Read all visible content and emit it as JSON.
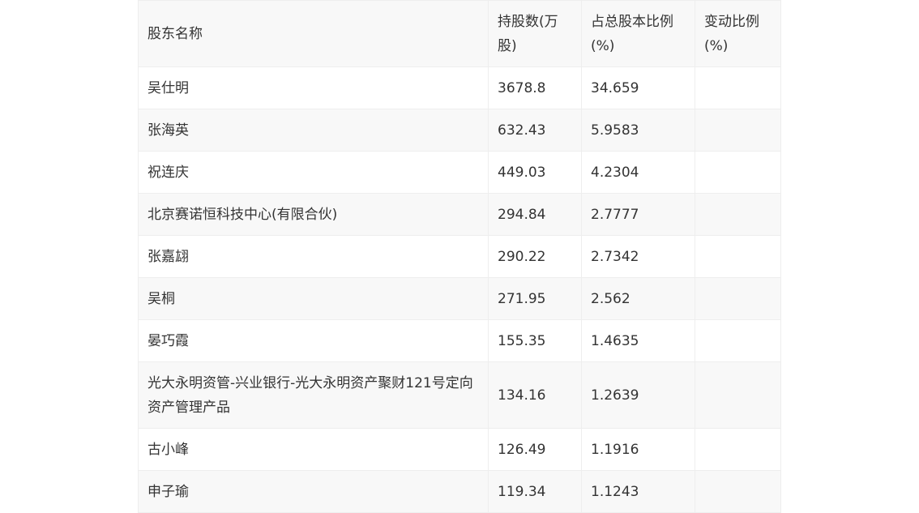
{
  "table": {
    "headers": [
      "股东名称",
      "持股数(万股)",
      "占总股本比例(%)",
      "变动比例(%)"
    ],
    "rows": [
      {
        "name": "吴仕明",
        "shares": "3678.8",
        "ratio": "34.659",
        "change": ""
      },
      {
        "name": "张海英",
        "shares": "632.43",
        "ratio": "5.9583",
        "change": ""
      },
      {
        "name": "祝连庆",
        "shares": "449.03",
        "ratio": "4.2304",
        "change": ""
      },
      {
        "name": "北京赛诺恒科技中心(有限合伙)",
        "shares": "294.84",
        "ratio": "2.7777",
        "change": ""
      },
      {
        "name": "张嘉翃",
        "shares": "290.22",
        "ratio": "2.7342",
        "change": ""
      },
      {
        "name": "吴桐",
        "shares": "271.95",
        "ratio": "2.562",
        "change": ""
      },
      {
        "name": "晏巧霞",
        "shares": "155.35",
        "ratio": "1.4635",
        "change": ""
      },
      {
        "name": "光大永明资管-兴业银行-光大永明资产聚财121号定向资产管理产品",
        "shares": "134.16",
        "ratio": "1.2639",
        "change": ""
      },
      {
        "name": "古小峰",
        "shares": "126.49",
        "ratio": "1.1916",
        "change": ""
      },
      {
        "name": "申子瑜",
        "shares": "119.34",
        "ratio": "1.1243",
        "change": ""
      }
    ]
  }
}
